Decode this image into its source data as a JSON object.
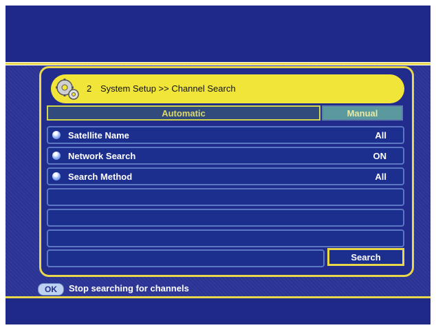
{
  "header": {
    "number": "2",
    "title": "System Setup >> Channel Search",
    "icon": "gear-icon"
  },
  "tabs": [
    {
      "label": "Automatic",
      "active": true
    },
    {
      "label": "Manual",
      "active": false
    }
  ],
  "settings": [
    {
      "label": "Satellite Name",
      "value": "All"
    },
    {
      "label": "Network Search",
      "value": "ON"
    },
    {
      "label": "Search Method",
      "value": "All"
    }
  ],
  "search_button": {
    "label": "Search"
  },
  "footer": {
    "key": "OK",
    "message": "Stop searching for channels"
  },
  "colors": {
    "background": "#2a3394",
    "accent": "#e9d94a",
    "header_bg": "#f2e53a",
    "row_bg": "#1d2f8e"
  }
}
